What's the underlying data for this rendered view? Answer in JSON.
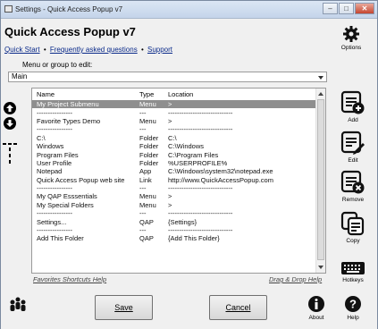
{
  "window": {
    "title": "Settings - Quick Access Popup v7"
  },
  "app": {
    "title": "Quick Access Popup v7"
  },
  "links": {
    "quick_start": "Quick Start",
    "faq": "Frequently asked questions",
    "support": "Support",
    "separator": "•"
  },
  "options": {
    "label": "Options"
  },
  "menu_select": {
    "label": "Menu or group to edit:",
    "value": "Main"
  },
  "list": {
    "columns": [
      "Name",
      "Type",
      "Location"
    ],
    "rows": [
      {
        "name": "My Project Submenu",
        "type": "Menu",
        "location": ">"
      },
      {
        "name": "----------------",
        "type": "---",
        "location": "-----------------------------"
      },
      {
        "name": "Favorite Types Demo",
        "type": "Menu",
        "location": ">"
      },
      {
        "name": "----------------",
        "type": "---",
        "location": "-----------------------------"
      },
      {
        "name": "C:\\",
        "type": "Folder",
        "location": "C:\\"
      },
      {
        "name": "Windows",
        "type": "Folder",
        "location": "C:\\Windows"
      },
      {
        "name": "Program Files",
        "type": "Folder",
        "location": "C:\\Program Files"
      },
      {
        "name": "User Profile",
        "type": "Folder",
        "location": "%USERPROFILE%"
      },
      {
        "name": "Notepad",
        "type": "App",
        "location": "C:\\Windows\\system32\\notepad.exe"
      },
      {
        "name": "Quick Access Popup web site",
        "type": "Link",
        "location": "http://www.QuickAccessPopup.com"
      },
      {
        "name": "----------------",
        "type": "---",
        "location": "-----------------------------"
      },
      {
        "name": "My QAP Esssentials",
        "type": "Menu",
        "location": ">"
      },
      {
        "name": "My Special Folders",
        "type": "Menu",
        "location": ">"
      },
      {
        "name": "----------------",
        "type": "---",
        "location": "-----------------------------"
      },
      {
        "name": "Settings...",
        "type": "QAP",
        "location": "{Settings}"
      },
      {
        "name": "----------------",
        "type": "---",
        "location": "-----------------------------"
      },
      {
        "name": "Add This Folder",
        "type": "QAP",
        "location": "{Add This Folder}"
      }
    ]
  },
  "bottom_links": {
    "favorites_help": "Favorites Shortcuts Help",
    "drag_drop_help": "Drag & Drop Help"
  },
  "buttons": {
    "save_label": "Save",
    "cancel_label": "Cancel"
  },
  "right_actions": {
    "add": "Add",
    "edit": "Edit",
    "remove": "Remove",
    "copy": "Copy",
    "hotkeys": "Hotkeys",
    "about": "About",
    "help": "Help"
  },
  "icons": {
    "options": "gear-icon",
    "move_up": "arrow-up-icon",
    "move_down": "arrow-down-icon",
    "separator": "separator-icon",
    "column_break": "column-break-icon",
    "donate": "people-icon"
  }
}
